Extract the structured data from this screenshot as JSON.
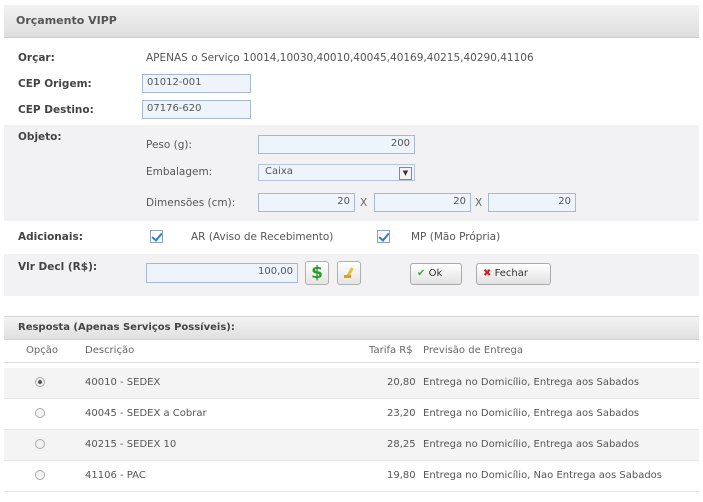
{
  "title": "Orçamento VIPP",
  "form": {
    "orcar_label": "Orçar:",
    "orcar_value": "APENAS o Serviço 10014,10030,40010,40045,40169,40215,40290,41106",
    "cep_origem_label": "CEP Origem:",
    "cep_origem_value": "01012-001",
    "cep_destino_label": "CEP Destino:",
    "cep_destino_value": "07176-620",
    "objeto_label": "Objeto:",
    "peso_label": "Peso (g):",
    "peso_value": "200",
    "embalagem_label": "Embalagem:",
    "embalagem_value": "Caixa",
    "dimensoes_label": "Dimensões (cm):",
    "dim_1": "20",
    "dim_2": "20",
    "dim_3": "20",
    "x_sep": "X",
    "adicionais_label": "Adicionais:",
    "ar_label": "AR (Aviso de Recebimento)",
    "mp_label": "MP (Mão Própria)",
    "vlr_label": "Vlr Decl (R$):",
    "vlr_value": "100,00",
    "money_icon": "$",
    "ok_label": "Ok",
    "fechar_label": "Fechar"
  },
  "results": {
    "section_title": "Resposta (Apenas Serviços Possíveis):",
    "columns": [
      "Opção",
      "Descrição",
      "Tarifa R$",
      "Previsão de Entrega"
    ],
    "rows": [
      {
        "descricao": "40010 - SEDEX",
        "tarifa": "20,80",
        "previsao": "Entrega no Domicílio, Entrega aos Sabados",
        "selected": true
      },
      {
        "descricao": "40045 - SEDEX a Cobrar",
        "tarifa": "23,20",
        "previsao": "Entrega no Domicílio, Entrega aos Sabados",
        "selected": false
      },
      {
        "descricao": "40215 - SEDEX 10",
        "tarifa": "28,25",
        "previsao": "Entrega no Domicílio, Entrega aos Sabados",
        "selected": false
      },
      {
        "descricao": "41106 - PAC",
        "tarifa": "19,80",
        "previsao": "Entrega no Domicílio, Nao Entrega aos Sabados",
        "selected": false
      }
    ]
  },
  "colors": {
    "accent_blue": "#2e7bd6",
    "money_green": "#2a9a2a",
    "close_red": "#cc2222",
    "ok_green": "#3aa63a"
  }
}
